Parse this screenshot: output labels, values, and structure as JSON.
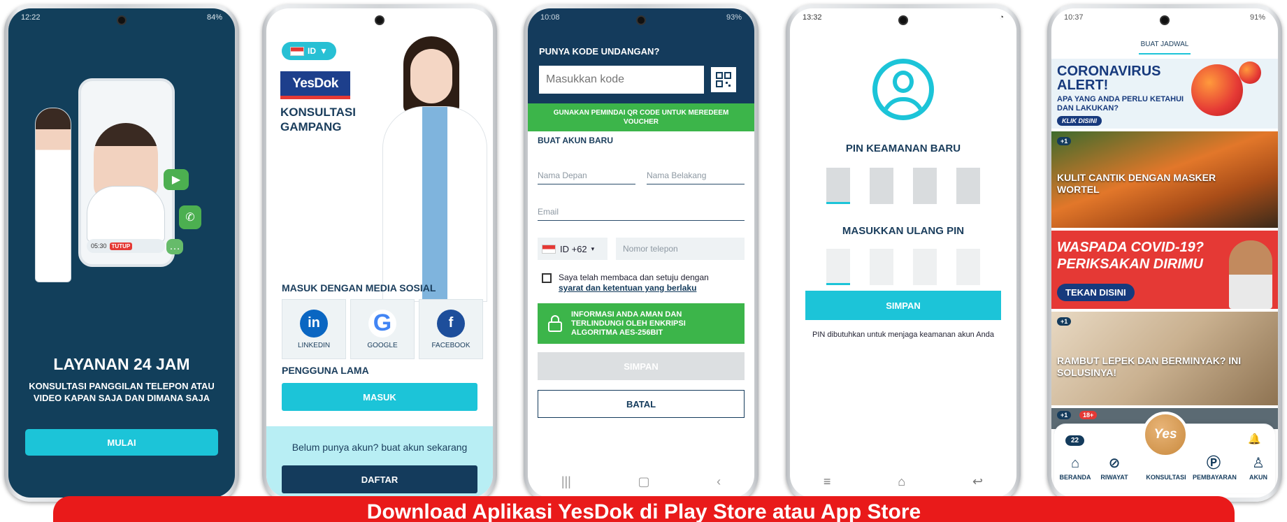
{
  "colors": {
    "navy": "#143b5c",
    "cyan": "#1cc4d8",
    "green": "#3cb54a",
    "red": "#e91a1a"
  },
  "phone1": {
    "time": "12:22",
    "battery": "84%",
    "call_timer": "05:30",
    "call_end": "TUTUP",
    "title": "LAYANAN 24 JAM",
    "subtitle": "KONSULTASI PANGGILAN TELEPON ATAU VIDEO KAPAN SAJA DAN DIMANA SAJA",
    "start_button": "MULAI"
  },
  "phone2": {
    "language": "ID",
    "logo": "YesDok",
    "tagline": "KONSULTASI GAMPANG",
    "social_heading": "MASUK DENGAN MEDIA SOSIAL",
    "social": [
      {
        "label": "LINKEDIN",
        "icon": "in",
        "color": "#0a66c2"
      },
      {
        "label": "GOOGLE",
        "icon": "G",
        "color": "#4285f4"
      },
      {
        "label": "FACEBOOK",
        "icon": "f",
        "color": "#1d4e9b"
      }
    ],
    "existing_heading": "PENGGUNA LAMA",
    "login_button": "MASUK",
    "signup_prompt": "Belum punya akun? buat akun sekarang",
    "register_button": "DAFTAR"
  },
  "phone3": {
    "time": "10:08",
    "battery": "93%",
    "invite_question": "PUNYA KODE UNDANGAN?",
    "code_placeholder": "Masukkan kode",
    "qr_notice": "GUNAKAN PEMINDAI QR CODE UNTUK MEREDEEM VOUCHER",
    "create_heading": "BUAT AKUN BARU",
    "first_name_placeholder": "Nama Depan",
    "last_name_placeholder": "Nama Belakang",
    "email_placeholder": "Email",
    "country_code": "ID +62",
    "phone_placeholder": "Nomor telepon",
    "agree_text": "Saya telah membaca dan setuju dengan",
    "terms_link": "syarat dan ketentuan yang berlaku",
    "security_info": "INFORMASI ANDA AMAN DAN TERLINDUNGI OLEH ENKRIPSI ALGORITMA AES-256BIT",
    "save_button": "SIMPAN",
    "cancel_button": "BATAL"
  },
  "phone4": {
    "time": "13:32",
    "new_pin_title": "PIN KEAMANAN BARU",
    "reenter_title": "MASUKKAN ULANG PIN",
    "save_button": "SIMPAN",
    "note": "PIN dibutuhkan untuk menjaga keamanan akun Anda"
  },
  "phone5": {
    "time": "10:37",
    "battery": "91%",
    "header": "BUAT JADWAL",
    "cards": {
      "covid_alert_title": "CORONAVIRUS ALERT!",
      "covid_alert_sub": "APA YANG ANDA PERLU KETAHUI DAN LAKUKAN?",
      "covid_alert_cta": "KLIK DISINI",
      "carrot_title": "KULIT CANTIK DENGAN MASKER WORTEL",
      "carrot_chip": "+1",
      "waspada_title": "WASPADA COVID-19? PERIKSAKAN DIRIMU",
      "waspada_cta": "TEKAN DISINI",
      "hair_title": "RAMBUT LEPEK DAN BERMINYAK? INI SOLUSINYA!",
      "hair_chip": "+1",
      "adult_chip": "18+"
    },
    "points_badge": "22",
    "center_button": "Yes",
    "tabs": [
      {
        "label": "BERANDA",
        "icon": "home-icon"
      },
      {
        "label": "RIWAYAT",
        "icon": "history-icon"
      },
      {
        "label": "KONSULTASI",
        "icon": "consult-icon"
      },
      {
        "label": "PEMBAYARAN",
        "icon": "payment-icon"
      },
      {
        "label": "AKUN",
        "icon": "account-icon"
      }
    ]
  },
  "banner": "Download Aplikasi YesDok di Play Store atau App Store"
}
